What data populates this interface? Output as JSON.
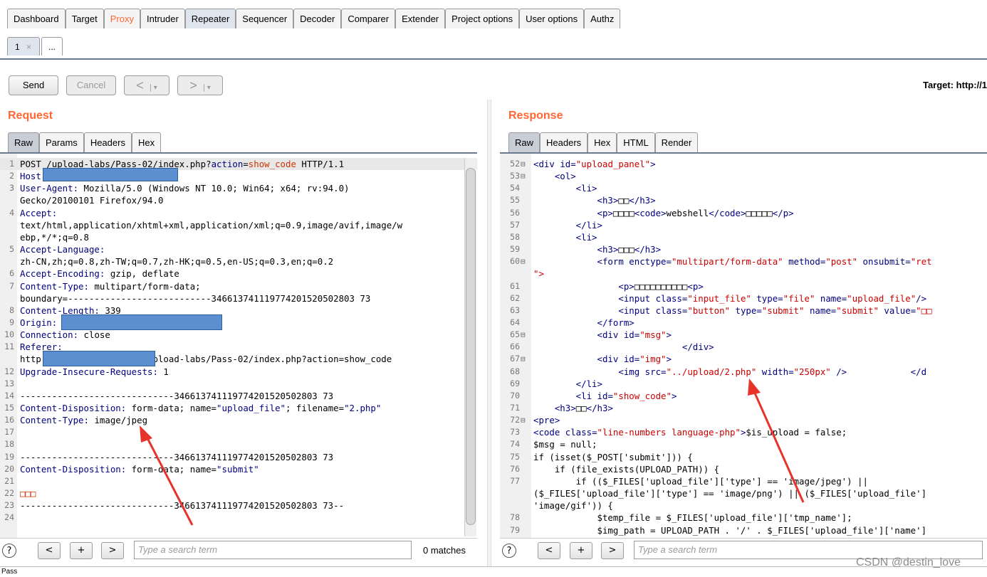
{
  "main_tabs": [
    "Dashboard",
    "Target",
    "Proxy",
    "Intruder",
    "Repeater",
    "Sequencer",
    "Decoder",
    "Comparer",
    "Extender",
    "Project options",
    "User options",
    "Authz"
  ],
  "sub_tabs": {
    "first": "1",
    "close": "×",
    "more": "..."
  },
  "toolbar": {
    "send": "Send",
    "cancel": "Cancel",
    "back": "<",
    "back_menu": "▾",
    "forward": ">",
    "forward_menu": "▾",
    "target": "Target: http://1"
  },
  "request": {
    "heading": "Request",
    "tabs": [
      "Raw",
      "Params",
      "Headers",
      "Hex"
    ],
    "lines": [
      {
        "n": "1",
        "parts": [
          [
            "POST /upload-labs/Pass-02/index.php?",
            ""
          ],
          [
            "action",
            "hn"
          ],
          [
            "=",
            ""
          ],
          [
            "show_code",
            "hv"
          ],
          [
            " HTTP/1.1",
            ""
          ]
        ]
      },
      {
        "n": "2",
        "parts": [
          [
            "Host:",
            "hn"
          ]
        ]
      },
      {
        "n": "3",
        "parts": [
          [
            "User-Agent:",
            "hn"
          ],
          [
            " Mozilla/5.0 (Windows NT 10.0; Win64; x64; rv:94.0)",
            ""
          ]
        ]
      },
      {
        "n": "",
        "parts": [
          [
            "Gecko/20100101 Firefox/94.0",
            ""
          ]
        ]
      },
      {
        "n": "4",
        "parts": [
          [
            "Accept:",
            "hn"
          ]
        ]
      },
      {
        "n": "",
        "parts": [
          [
            "text/html,application/xhtml+xml,application/xml;q=0.9,image/avif,image/w",
            ""
          ]
        ]
      },
      {
        "n": "",
        "parts": [
          [
            "ebp,*/*;q=0.8",
            ""
          ]
        ]
      },
      {
        "n": "5",
        "parts": [
          [
            "Accept-Language:",
            "hn"
          ]
        ]
      },
      {
        "n": "",
        "parts": [
          [
            "zh-CN,zh;q=0.8,zh-TW;q=0.7,zh-HK;q=0.5,en-US;q=0.3,en;q=0.2",
            ""
          ]
        ]
      },
      {
        "n": "6",
        "parts": [
          [
            "Accept-Encoding:",
            "hn"
          ],
          [
            " gzip, deflate",
            ""
          ]
        ]
      },
      {
        "n": "7",
        "parts": [
          [
            "Content-Type:",
            "hn"
          ],
          [
            " multipart/form-data;",
            ""
          ]
        ]
      },
      {
        "n": "",
        "parts": [
          [
            "boundary=---------------------------346613741119774201520502803 73",
            ""
          ]
        ]
      },
      {
        "n": "8",
        "parts": [
          [
            "Content-Length:",
            "hn"
          ],
          [
            " 339",
            ""
          ]
        ]
      },
      {
        "n": "9",
        "parts": [
          [
            "Origin:",
            "hn"
          ]
        ]
      },
      {
        "n": "10",
        "parts": [
          [
            "Connection:",
            "hn"
          ],
          [
            " close",
            ""
          ]
        ]
      },
      {
        "n": "11",
        "parts": [
          [
            "Referer:",
            "hn"
          ]
        ]
      },
      {
        "n": "",
        "parts": [
          [
            "http",
            ""
          ],
          [
            "                    ",
            ""
          ],
          [
            "upload-labs/Pass-02/index.php?action=show_code",
            ""
          ]
        ]
      },
      {
        "n": "12",
        "parts": [
          [
            "Upgrade-Insecure-Requests:",
            "hn"
          ],
          [
            " 1",
            ""
          ]
        ]
      },
      {
        "n": "13",
        "parts": [
          [
            "",
            ""
          ]
        ]
      },
      {
        "n": "14",
        "parts": [
          [
            "-----------------------------346613741119774201520502803 73",
            ""
          ]
        ]
      },
      {
        "n": "15",
        "parts": [
          [
            "Content-Disposition:",
            "hn"
          ],
          [
            " form-data; name=",
            ""
          ],
          [
            "\"upload_file\"",
            "hn"
          ],
          [
            "; filename=",
            ""
          ],
          [
            "\"2.php\"",
            "hn"
          ]
        ]
      },
      {
        "n": "16",
        "parts": [
          [
            "Content-Type:",
            "hn"
          ],
          [
            " image/jpeg",
            ""
          ]
        ]
      },
      {
        "n": "17",
        "parts": [
          [
            "",
            ""
          ]
        ]
      },
      {
        "n": "18",
        "parts": [
          [
            "",
            ""
          ]
        ]
      },
      {
        "n": "19",
        "parts": [
          [
            "-----------------------------346613741119774201520502803 73",
            ""
          ]
        ]
      },
      {
        "n": "20",
        "parts": [
          [
            "Content-Disposition:",
            "hn"
          ],
          [
            " form-data; name=",
            ""
          ],
          [
            "\"submit\"",
            "hn"
          ]
        ]
      },
      {
        "n": "21",
        "parts": [
          [
            "",
            ""
          ]
        ]
      },
      {
        "n": "22",
        "parts": [
          [
            "□□□",
            "hv"
          ]
        ]
      },
      {
        "n": "23",
        "parts": [
          [
            "-----------------------------346613741119774201520502803 73--",
            ""
          ]
        ]
      },
      {
        "n": "24",
        "parts": [
          [
            "",
            ""
          ]
        ]
      }
    ],
    "search_placeholder": "Type a search term",
    "matches": "0 matches"
  },
  "response": {
    "heading": "Response",
    "tabs": [
      "Raw",
      "Headers",
      "Hex",
      "HTML",
      "Render"
    ],
    "lines": [
      {
        "n": "52",
        "f": "⊟",
        "parts": [
          [
            "<div ",
            "tag"
          ],
          [
            "id=",
            "att"
          ],
          [
            "\"upload_panel\"",
            "str"
          ],
          [
            ">",
            "tag"
          ]
        ]
      },
      {
        "n": "53",
        "f": "⊟",
        "parts": [
          [
            "    <ol>",
            "tag"
          ]
        ]
      },
      {
        "n": "54",
        "f": "",
        "parts": [
          [
            "        <li>",
            "tag"
          ]
        ]
      },
      {
        "n": "55",
        "f": "",
        "parts": [
          [
            "            <h3>",
            "tag"
          ],
          [
            "□□",
            ""
          ],
          [
            "</h3>",
            "tag"
          ]
        ]
      },
      {
        "n": "56",
        "f": "",
        "parts": [
          [
            "            <p>",
            "tag"
          ],
          [
            "□□□□",
            ""
          ],
          [
            "<code>",
            "tag"
          ],
          [
            "webshell",
            ""
          ],
          [
            "</code>",
            "tag"
          ],
          [
            "□□□□□",
            ""
          ],
          [
            "</p>",
            "tag"
          ]
        ]
      },
      {
        "n": "57",
        "f": "",
        "parts": [
          [
            "        </li>",
            "tag"
          ]
        ]
      },
      {
        "n": "58",
        "f": "",
        "parts": [
          [
            "        <li>",
            "tag"
          ]
        ]
      },
      {
        "n": "59",
        "f": "",
        "parts": [
          [
            "            <h3>",
            "tag"
          ],
          [
            "□□□",
            ""
          ],
          [
            "</h3>",
            "tag"
          ]
        ]
      },
      {
        "n": "60",
        "f": "⊟",
        "parts": [
          [
            "            <form ",
            "tag"
          ],
          [
            "enctype=",
            "att"
          ],
          [
            "\"multipart/form-data\"",
            "str"
          ],
          [
            " method=",
            "att"
          ],
          [
            "\"post\"",
            "str"
          ],
          [
            " onsubmit=",
            "att"
          ],
          [
            "\"ret",
            "str"
          ]
        ]
      },
      {
        "n": "",
        "f": "",
        "parts": [
          [
            "\">",
            "str"
          ]
        ]
      },
      {
        "n": "61",
        "f": "",
        "parts": [
          [
            "                <p>",
            "tag"
          ],
          [
            "□□□□□□□□□□",
            ""
          ],
          [
            "<p>",
            "tag"
          ]
        ]
      },
      {
        "n": "62",
        "f": "",
        "parts": [
          [
            "                <input ",
            "tag"
          ],
          [
            "class=",
            "att"
          ],
          [
            "\"input_file\"",
            "str"
          ],
          [
            " type=",
            "att"
          ],
          [
            "\"file\"",
            "str"
          ],
          [
            " name=",
            "att"
          ],
          [
            "\"upload_file\"",
            "str"
          ],
          [
            "/>",
            "tag"
          ]
        ]
      },
      {
        "n": "63",
        "f": "",
        "parts": [
          [
            "                <input ",
            "tag"
          ],
          [
            "class=",
            "att"
          ],
          [
            "\"button\"",
            "str"
          ],
          [
            " type=",
            "att"
          ],
          [
            "\"submit\"",
            "str"
          ],
          [
            " name=",
            "att"
          ],
          [
            "\"submit\"",
            "str"
          ],
          [
            " value=",
            "att"
          ],
          [
            "\"□□",
            "str"
          ]
        ]
      },
      {
        "n": "64",
        "f": "",
        "parts": [
          [
            "            </form>",
            "tag"
          ]
        ]
      },
      {
        "n": "65",
        "f": "⊟",
        "parts": [
          [
            "            <div ",
            "tag"
          ],
          [
            "id=",
            "att"
          ],
          [
            "\"msg\"",
            "str"
          ],
          [
            ">",
            "tag"
          ]
        ]
      },
      {
        "n": "66",
        "f": "",
        "parts": [
          [
            "                            </div>",
            "tag"
          ]
        ]
      },
      {
        "n": "67",
        "f": "⊟",
        "parts": [
          [
            "            <div ",
            "tag"
          ],
          [
            "id=",
            "att"
          ],
          [
            "\"img\"",
            "str"
          ],
          [
            ">",
            "tag"
          ]
        ]
      },
      {
        "n": "68",
        "f": "",
        "parts": [
          [
            "                <img ",
            "tag"
          ],
          [
            "src=",
            "att"
          ],
          [
            "\"../upload/2.php\"",
            "str"
          ],
          [
            " width=",
            "att"
          ],
          [
            "\"250px\"",
            "str"
          ],
          [
            " />",
            "tag"
          ],
          [
            "            </d",
            "tag"
          ]
        ]
      },
      {
        "n": "69",
        "f": "",
        "parts": [
          [
            "        </li>",
            "tag"
          ]
        ]
      },
      {
        "n": "70",
        "f": "",
        "parts": [
          [
            "        <li ",
            "tag"
          ],
          [
            "id=",
            "att"
          ],
          [
            "\"show_code\"",
            "str"
          ],
          [
            ">",
            "tag"
          ]
        ]
      },
      {
        "n": "71",
        "f": "",
        "parts": [
          [
            "    <h3>",
            "tag"
          ],
          [
            "□□",
            ""
          ],
          [
            "</h3>",
            "tag"
          ]
        ]
      },
      {
        "n": "72",
        "f": "⊟",
        "parts": [
          [
            "<pre>",
            "tag"
          ]
        ]
      },
      {
        "n": "73",
        "f": "",
        "parts": [
          [
            "<code ",
            "tag"
          ],
          [
            "class=",
            "att"
          ],
          [
            "\"line-numbers language-php\"",
            "str"
          ],
          [
            ">",
            "tag"
          ],
          [
            "$is_upload = false;",
            ""
          ]
        ]
      },
      {
        "n": "74",
        "f": "",
        "parts": [
          [
            "$msg = null;",
            ""
          ]
        ]
      },
      {
        "n": "75",
        "f": "",
        "parts": [
          [
            "if (isset($_POST['submit'])) {",
            ""
          ]
        ]
      },
      {
        "n": "76",
        "f": "",
        "parts": [
          [
            "    if (file_exists(UPLOAD_PATH)) {",
            ""
          ]
        ]
      },
      {
        "n": "77",
        "f": "",
        "parts": [
          [
            "        if (($_FILES['upload_file']['type'] == 'image/jpeg') ||",
            ""
          ]
        ]
      },
      {
        "n": "",
        "f": "",
        "parts": [
          [
            "($_FILES['upload_file']['type'] == 'image/png') || ($_FILES['upload_file']",
            ""
          ]
        ]
      },
      {
        "n": "",
        "f": "",
        "parts": [
          [
            "'image/gif')) {",
            ""
          ]
        ]
      },
      {
        "n": "78",
        "f": "",
        "parts": [
          [
            "            $temp_file = $_FILES['upload_file']['tmp_name'];",
            ""
          ]
        ]
      },
      {
        "n": "79",
        "f": "",
        "parts": [
          [
            "            $img_path = UPLOAD_PATH . '/' . $_FILES['upload_file']['name']",
            ""
          ]
        ]
      }
    ],
    "search_placeholder": "Type a search term"
  },
  "search_buttons": {
    "prev": "<",
    "add": "+",
    "next": ">",
    "help": "?"
  },
  "status_text": "Pass",
  "watermark": "CSDN @destin_love",
  "colors": {
    "accent": "#ff6633",
    "redact": "#5b8fd0",
    "tab_active": "#dfe5ef"
  }
}
